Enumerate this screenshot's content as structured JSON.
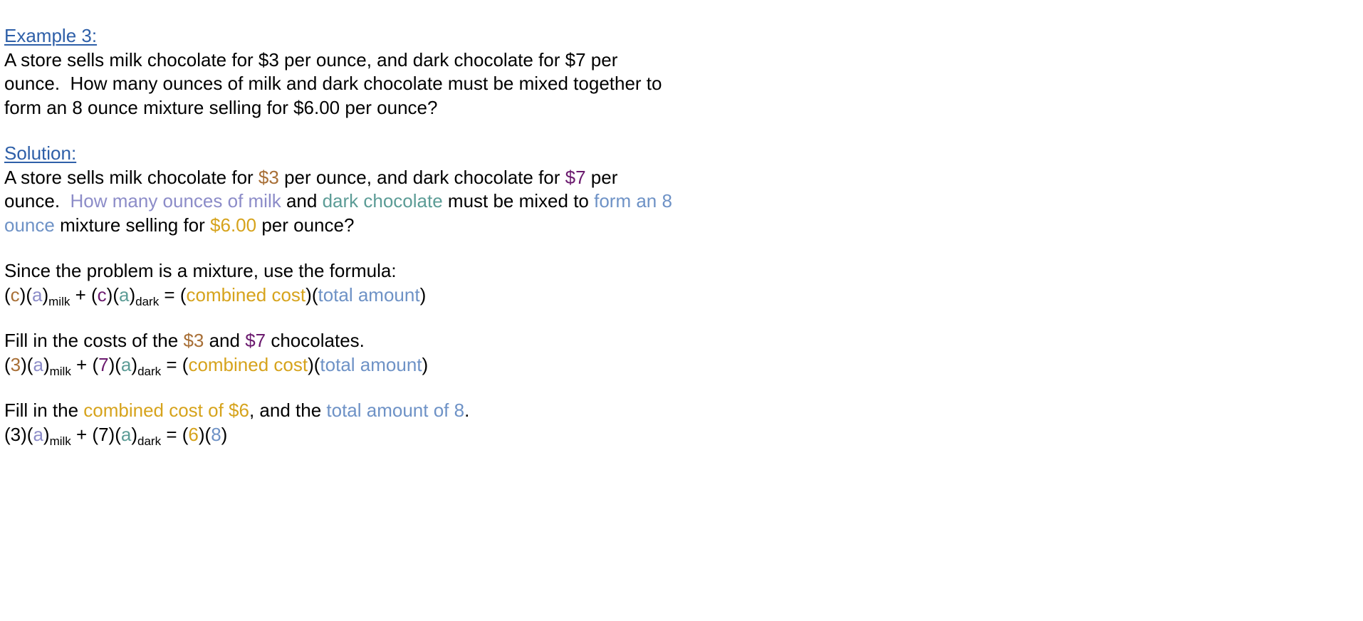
{
  "example": {
    "heading": "Example 3:",
    "line1": "A store sells milk chocolate for $3 per ounce, and dark chocolate for $7 per",
    "line2": "ounce.  How many ounces of milk and dark chocolate must be mixed together to",
    "line3": "form an 8 ounce mixture selling for $6.00 per ounce?"
  },
  "solution": {
    "heading": "Solution:",
    "line1": [
      "A store sells milk chocolate for ",
      "$3",
      " per ounce, and dark chocolate for ",
      "$7",
      " per"
    ],
    "line2": [
      "ounce.  ",
      "How many ounces of milk",
      " and ",
      "dark chocolate",
      " must be mixed to ",
      "form an 8"
    ],
    "line3": [
      "ounce",
      " mixture selling for ",
      "$6.00",
      " per ounce?"
    ]
  },
  "formula": {
    "intro": "Since the problem is a mixture, use the formula:",
    "tokens": [
      "(",
      "c",
      ")(",
      "a",
      ")",
      "milk",
      " + (",
      "c",
      ")(",
      "a",
      ")",
      "dark",
      " = (",
      "combined cost",
      ")(",
      "total amount",
      ")"
    ]
  },
  "step1": {
    "text": [
      "Fill in the costs of the ",
      "$3",
      " and ",
      "$7",
      " chocolates."
    ],
    "tokens": [
      "(",
      "3",
      ")(",
      "a",
      ")",
      "milk",
      " + (",
      "7",
      ")(",
      "a",
      ")",
      "dark",
      " = (",
      "combined cost",
      ")(",
      "total amount",
      ")"
    ]
  },
  "step2": {
    "text": [
      "Fill in the ",
      "combined cost of $6",
      ", and the ",
      "total amount of 8",
      "."
    ],
    "tokens": [
      "(3)(",
      "a",
      ")",
      "milk",
      " + (7)(",
      "a",
      ")",
      "dark",
      " = (",
      "6",
      ")(",
      "8",
      ")"
    ]
  },
  "colors": {
    "heading": "#2e5fa8",
    "milk_cost": "#a86f36",
    "dark_cost": "#6b1a6e",
    "milk_amount": "#8c8cc8",
    "dark_amount": "#5c9c96",
    "total_amount": "#6e92c6",
    "combined_cost": "#d6a31c"
  }
}
